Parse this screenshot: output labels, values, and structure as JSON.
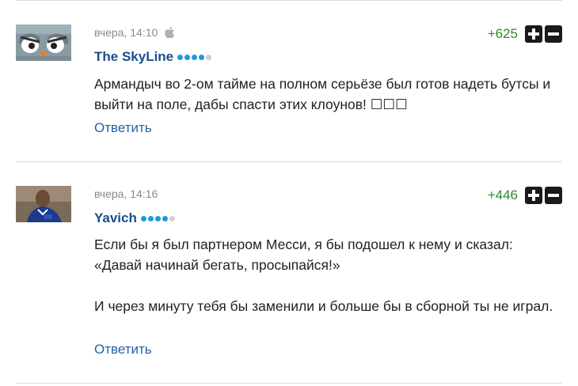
{
  "comments": [
    {
      "time": "вчера, 14:10",
      "device_icon": "apple-icon",
      "author": "The SkyLine",
      "rank_level": 4,
      "rank_max": 5,
      "score": "+625",
      "paragraphs": [
        "Армандыч во 2-ом тайме на полном серьёзе был готов надеть бутсы и выйти на поле, дабы спасти этих клоунов! ☐☐☐"
      ],
      "reply_label": "Ответить"
    },
    {
      "time": "вчера, 14:16",
      "author": "Yavich",
      "rank_level": 4,
      "rank_max": 5,
      "score": "+446",
      "paragraphs": [
        "Если бы я был партнером Месси, я бы подошел к нему и сказал: «Давай начинай бегать, просыпайся!»",
        "И через минуту тебя бы заменили и больше бы в сборной ты не играл."
      ],
      "reply_label": "Ответить"
    }
  ],
  "colors": {
    "author": "#1a4f8b",
    "score_positive": "#2e8b2e",
    "rank_on": "#1e9bd7",
    "rank_off": "#cfcfcf",
    "reply": "#1f62a8"
  }
}
